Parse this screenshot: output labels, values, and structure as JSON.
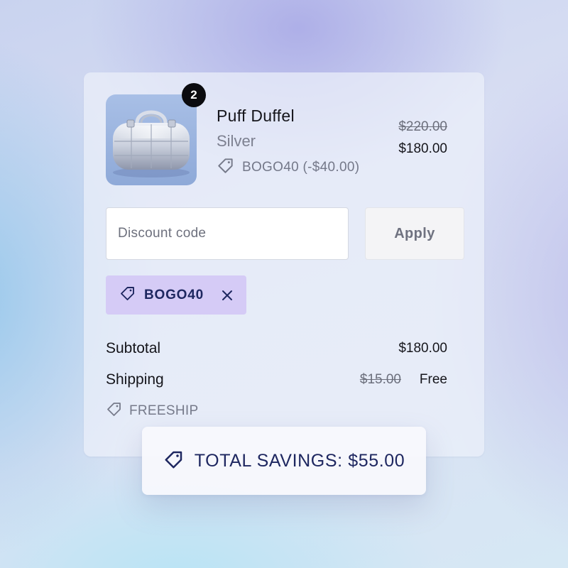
{
  "product": {
    "name": "Puff Duffel",
    "variant": "Silver",
    "quantity": "2",
    "discount_line": "BOGO40 (-$40.00)",
    "original_price": "$220.00",
    "final_price": "$180.00"
  },
  "discount_form": {
    "placeholder": "Discount code",
    "value": "",
    "apply_label": "Apply"
  },
  "applied_code": {
    "label": "BOGO40"
  },
  "summary": {
    "subtotal_label": "Subtotal",
    "subtotal_value": "$180.00",
    "shipping_label": "Shipping",
    "shipping_original": "$15.00",
    "shipping_value": "Free",
    "shipping_code": "FREESHIP"
  },
  "savings": {
    "label": "TOTAL SAVINGS: $55.00"
  },
  "icons": {
    "tag": "tag-icon",
    "remove": "close-icon"
  },
  "colors": {
    "chip_background": "#d5cbf6",
    "accent_text": "#1e2760",
    "badge": "#0b0b0f"
  }
}
